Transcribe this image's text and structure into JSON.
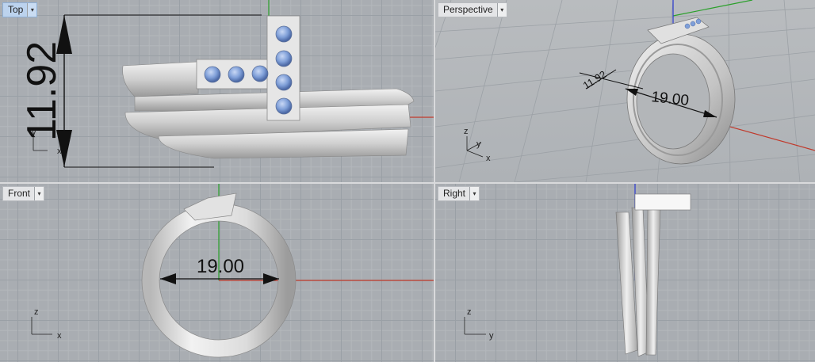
{
  "viewports": {
    "top": {
      "title": "Top",
      "active": true
    },
    "perspective": {
      "title": "Perspective"
    },
    "front": {
      "title": "Front"
    },
    "right": {
      "title": "Right"
    }
  },
  "menu_glyph": "▾",
  "dimensions": {
    "ring_height": "11.92",
    "ring_diameter": "19.00"
  },
  "axis_labels": {
    "x": "x",
    "y": "y",
    "z": "z"
  },
  "colors": {
    "x_axis": "#c0392b",
    "y_axis": "#2aa02a",
    "z_axis": "#2c3bd0",
    "metal": "#d8d8d8",
    "gem": "#7f9fd8",
    "active_title": "#bcd3ee"
  }
}
